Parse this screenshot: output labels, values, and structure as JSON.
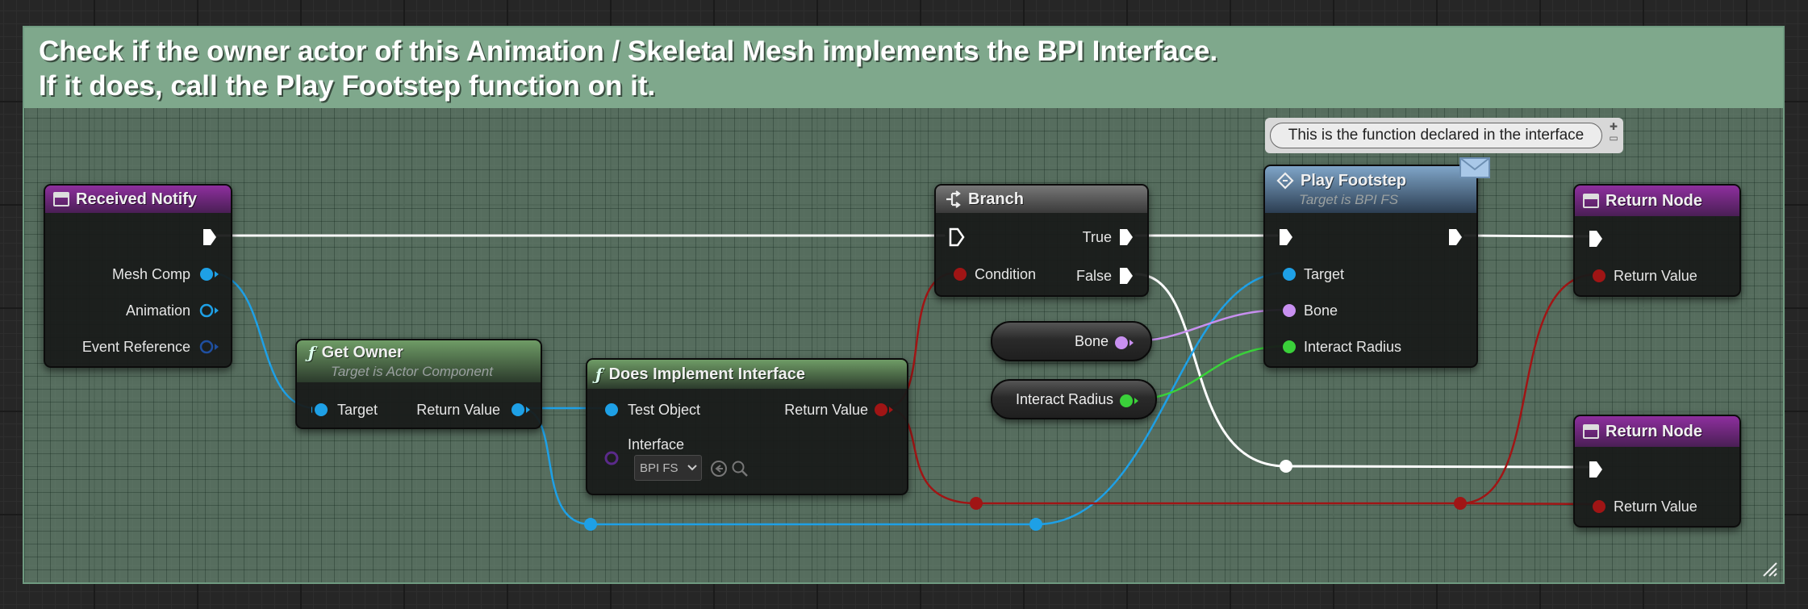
{
  "comment": {
    "line1": "Check if the owner actor of this Animation / Skeletal Mesh implements the BPI Interface.",
    "line2": "If it does, call the Play Footstep function on it."
  },
  "bubble": {
    "text": "This is the function declared in the interface"
  },
  "nodes": {
    "received_notify": {
      "title": "Received Notify",
      "pins": {
        "mesh_comp": "Mesh Comp",
        "animation": "Animation",
        "event_reference": "Event Reference"
      }
    },
    "get_owner": {
      "title": "Get Owner",
      "subtitle": "Target is Actor Component",
      "pins": {
        "target": "Target",
        "return_value": "Return Value"
      }
    },
    "does_implement": {
      "title": "Does Implement Interface",
      "pins": {
        "test_object": "Test Object",
        "return_value": "Return Value",
        "interface": "Interface"
      },
      "interface_value": "BPI FS"
    },
    "branch": {
      "title": "Branch",
      "pins": {
        "condition": "Condition",
        "true": "True",
        "false": "False"
      }
    },
    "play_footstep": {
      "title": "Play Footstep",
      "subtitle": "Target is BPI FS",
      "pins": {
        "target": "Target",
        "bone": "Bone",
        "interact_radius": "Interact Radius"
      }
    },
    "return_node_1": {
      "title": "Return Node",
      "pins": {
        "return_value": "Return Value"
      }
    },
    "return_node_2": {
      "title": "Return Node",
      "pins": {
        "return_value": "Return Value"
      }
    },
    "var_bone": {
      "label": "Bone"
    },
    "var_interact_radius": {
      "label": "Interact Radius"
    }
  },
  "colors": {
    "exec": "#ffffff",
    "object": "#1ea0e6",
    "bool": "#a01515",
    "name": "#c890f0",
    "float": "#3ad13a",
    "interface": "#5a2a8a",
    "comment_header": "#7fa88c"
  }
}
